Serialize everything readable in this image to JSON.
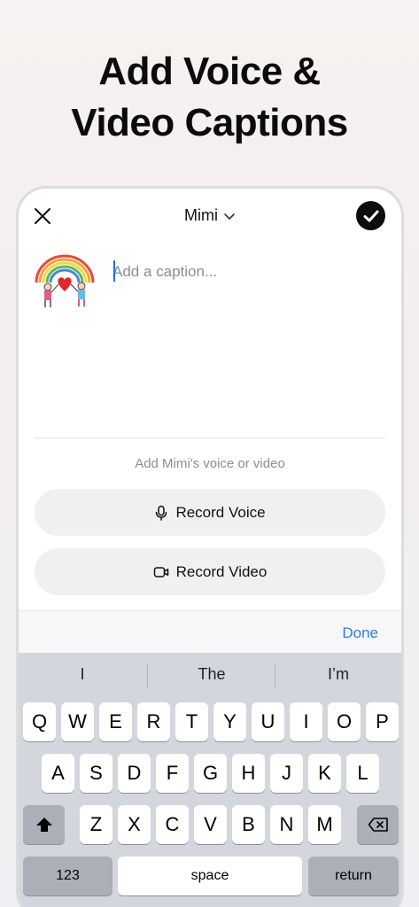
{
  "headline": {
    "line1": "Add Voice &",
    "line2": "Video Captions"
  },
  "topbar": {
    "recipient": "Mimi"
  },
  "caption": {
    "placeholder": "Add a caption..."
  },
  "prompt": "Add Mimi's voice or video",
  "buttons": {
    "record_voice": "Record Voice",
    "record_video": "Record Video",
    "done": "Done"
  },
  "keyboard": {
    "suggestions": [
      "I",
      "The",
      "I’m"
    ],
    "row1": [
      "Q",
      "W",
      "E",
      "R",
      "T",
      "Y",
      "U",
      "I",
      "O",
      "P"
    ],
    "row2": [
      "A",
      "S",
      "D",
      "F",
      "G",
      "H",
      "J",
      "K",
      "L"
    ],
    "row3": [
      "Z",
      "X",
      "C",
      "V",
      "B",
      "N",
      "M"
    ],
    "numbers": "123",
    "space": "space",
    "return": "return"
  },
  "colors": {
    "accent": "#2d7fe0",
    "keyboard_bg": "#d3d6dc",
    "pill_bg": "#f0f0f0"
  }
}
